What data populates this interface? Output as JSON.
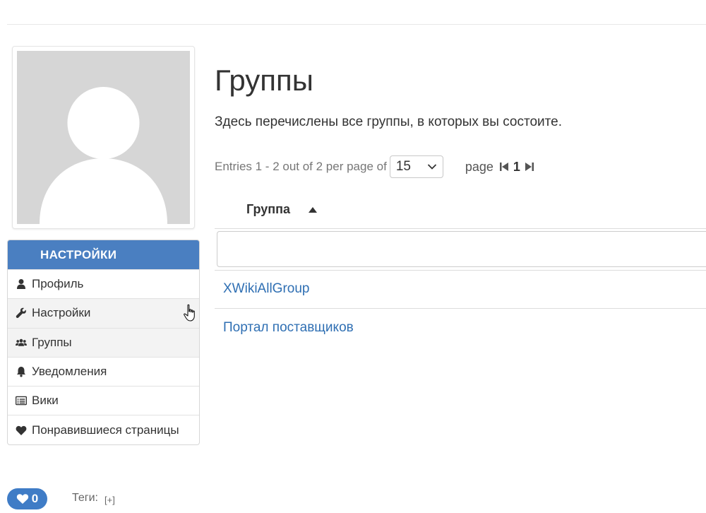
{
  "settings": {
    "heading": "НАСТРОЙКИ",
    "items": [
      {
        "label": "Профиль",
        "icon": "user-icon"
      },
      {
        "label": "Настройки",
        "icon": "wrench-icon"
      },
      {
        "label": "Группы",
        "icon": "users-icon"
      },
      {
        "label": "Уведомления",
        "icon": "bell-icon"
      },
      {
        "label": "Вики",
        "icon": "list-icon"
      },
      {
        "label": "Понравившиеся страницы",
        "icon": "heart-icon"
      }
    ]
  },
  "main": {
    "title": "Группы",
    "description": "Здесь перечислены все группы, в которых вы состоите.",
    "pager": {
      "entries_text": "Entries 1 - 2 out of 2 per page of",
      "per_page": "15",
      "page_label": "page",
      "current_page": "1"
    },
    "table": {
      "column_header": "Группа",
      "filter_value": "",
      "rows": [
        {
          "name": "XWikiAllGroup"
        },
        {
          "name": "Портал поставщиков"
        }
      ]
    }
  },
  "footer": {
    "like_count": "0",
    "tags_label": "Теги:",
    "tags_add": "[+]"
  },
  "colors": {
    "accent": "#4a7fc1",
    "link": "#2f6fb3"
  }
}
